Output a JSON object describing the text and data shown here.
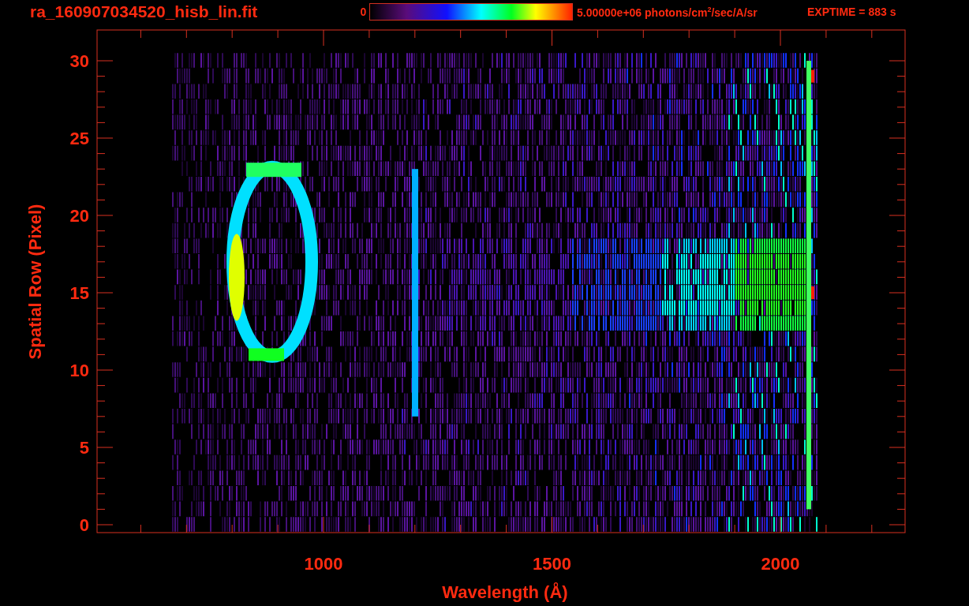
{
  "plot_window": {
    "title": "ra_160907034520_hisb_lin.fit",
    "colorbar": {
      "min_label": "0",
      "max_label": "5.00000e+06 photons/cm$^{2}$/sec/A/sr"
    },
    "exposure": "EXPTIME = 883 s",
    "x_axis": {
      "label": "Wavelength (Å)",
      "tick_labels": [
        "1000",
        "1500",
        "2000"
      ]
    },
    "y_axis": {
      "label": "Spatial Row (Pixel)",
      "tick_labels": [
        "30",
        "25",
        "20",
        "15",
        "10",
        "5",
        "0"
      ]
    }
  }
}
